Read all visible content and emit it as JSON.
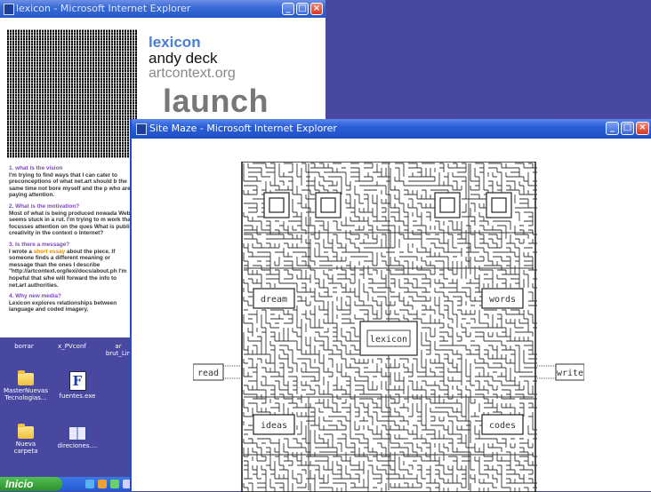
{
  "back_window": {
    "title": "lexicon - Microsoft Internet Explorer",
    "lexicon": "lexicon",
    "author": "andy deck",
    "site": "artcontext.org",
    "launch": "launch",
    "faq": [
      {
        "q": "1. what is the vision",
        "a": "I'm trying to find ways that I can cater to preconceptions of what net.art should b the same time not bore myself and the p who are paying attention."
      },
      {
        "q": "2. What is the motivation?",
        "a": "Most of what is being produced nowada Web seems stuck in a rut. I'm trying to m work that focusses attention on the ques What is public creativity in the context o Internet?"
      },
      {
        "q": "3. Is there a message?",
        "a1": "I wrote a ",
        "link": "short essay",
        "a2": " about the piece. If someone finds a different meaning or message than the ones I describe \"http://artcontext.org/lexi/docs/about.ph I'm hopeful that s/he will forward the info to net.art authorities."
      },
      {
        "q": "4. Why new media?",
        "a": "Lexicon explores relationships between language and coded imagery."
      }
    ]
  },
  "desktop": {
    "icons": [
      {
        "label": "borrar"
      },
      {
        "label": "x_PVconf"
      },
      {
        "label": "ar brut_Lin"
      },
      {
        "label": "MasterNuevas Tecnologias..."
      },
      {
        "label": "fuentes.exe"
      },
      {
        "label": "Nueva carpeta"
      },
      {
        "label": "direciones...."
      }
    ]
  },
  "taskbar": {
    "start_label": "Inicio"
  },
  "front_window": {
    "title": "Site Maze - Microsoft Internet Explorer",
    "maze_labels": [
      "read",
      "write",
      "lexicon",
      "dream",
      "words",
      "ideas",
      "codes"
    ]
  }
}
